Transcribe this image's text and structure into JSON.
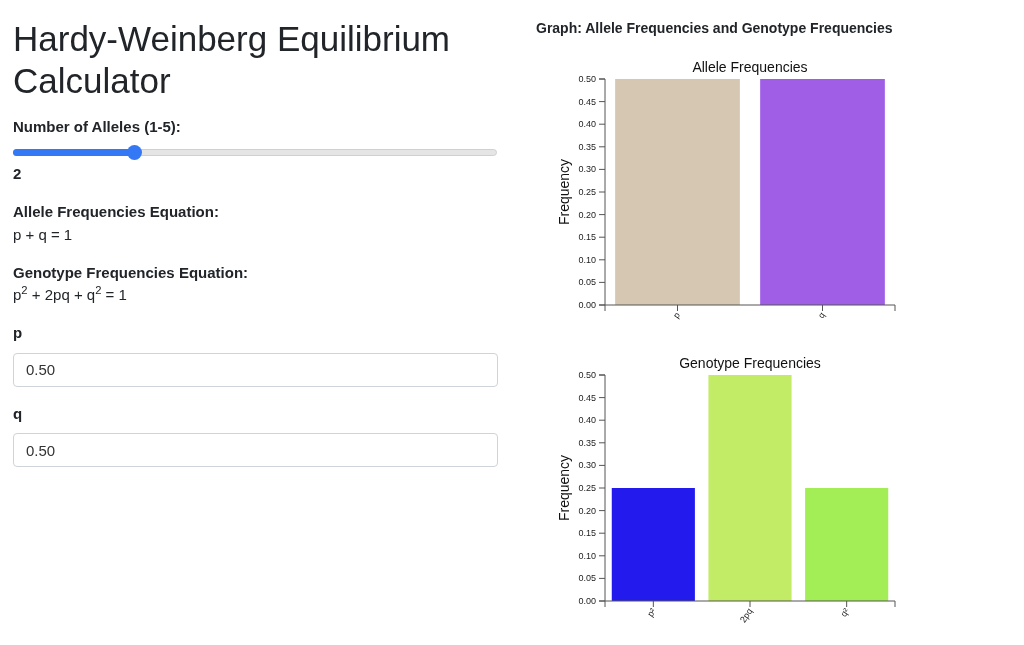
{
  "title": "Hardy-Weinberg Equilibrium Calculator",
  "alleles_slider": {
    "label": "Number of Alleles (1-5):",
    "level": 0.25,
    "value": "2"
  },
  "equations": [
    {
      "label": "Allele Frequencies Equation:",
      "text": "p + q = 1"
    },
    {
      "label": "Genotype Frequencies Equation:",
      "text": "p$^{2}$ + 2pq + q$^{2}$ = 1"
    }
  ],
  "fields": [
    {
      "label": "p",
      "value": "0.50"
    },
    {
      "label": "q",
      "value": "0.50"
    }
  ],
  "graph_heading": "Graph: Allele Frequencies and Genotype Frequencies",
  "charts": [
    {
      "chart_data": {
        "type": "bar",
        "title": "Allele Frequencies",
        "ylabel": "Frequency",
        "categories": [
          "p",
          "q"
        ],
        "colors": [
          "#d5c7b1",
          "#a05ee6"
        ],
        "values": [
          0.5,
          0.5
        ],
        "ylim": [
          0,
          0.5
        ],
        "yticks": [
          {
            "value": 0,
            "label": "0.00"
          },
          {
            "value": 0.05,
            "label": "0.05"
          },
          {
            "value": 0.1,
            "label": "0.10"
          },
          {
            "value": 0.15,
            "label": "0.15"
          },
          {
            "value": 0.2,
            "label": "0.20"
          },
          {
            "value": 0.25,
            "label": "0.25"
          },
          {
            "value": 0.3,
            "label": "0.30"
          },
          {
            "value": 0.35,
            "label": "0.35"
          },
          {
            "value": 0.4,
            "label": "0.40"
          },
          {
            "value": 0.45,
            "label": "0.45"
          },
          {
            "value": 0.5,
            "label": "0.50"
          }
        ]
      }
    },
    {
      "chart_data": {
        "type": "bar",
        "title": "Genotype Frequencies",
        "ylabel": "Frequency",
        "categories": [
          "p²",
          "2pq",
          "q²"
        ],
        "colors": [
          "#231aee",
          "#c2ec66",
          "#a3ed56"
        ],
        "values": [
          0.25,
          0.5,
          0.25
        ],
        "ylim": [
          0,
          0.5
        ],
        "yticks": [
          {
            "value": 0,
            "label": "0.00"
          },
          {
            "value": 0.05,
            "label": "0.05"
          },
          {
            "value": 0.1,
            "label": "0.10"
          },
          {
            "value": 0.15,
            "label": "0.15"
          },
          {
            "value": 0.2,
            "label": "0.20"
          },
          {
            "value": 0.25,
            "label": "0.25"
          },
          {
            "value": 0.3,
            "label": "0.30"
          },
          {
            "value": 0.35,
            "label": "0.35"
          },
          {
            "value": 0.4,
            "label": "0.40"
          },
          {
            "value": 0.45,
            "label": "0.45"
          },
          {
            "value": 0.5,
            "label": "0.50"
          }
        ]
      }
    }
  ]
}
